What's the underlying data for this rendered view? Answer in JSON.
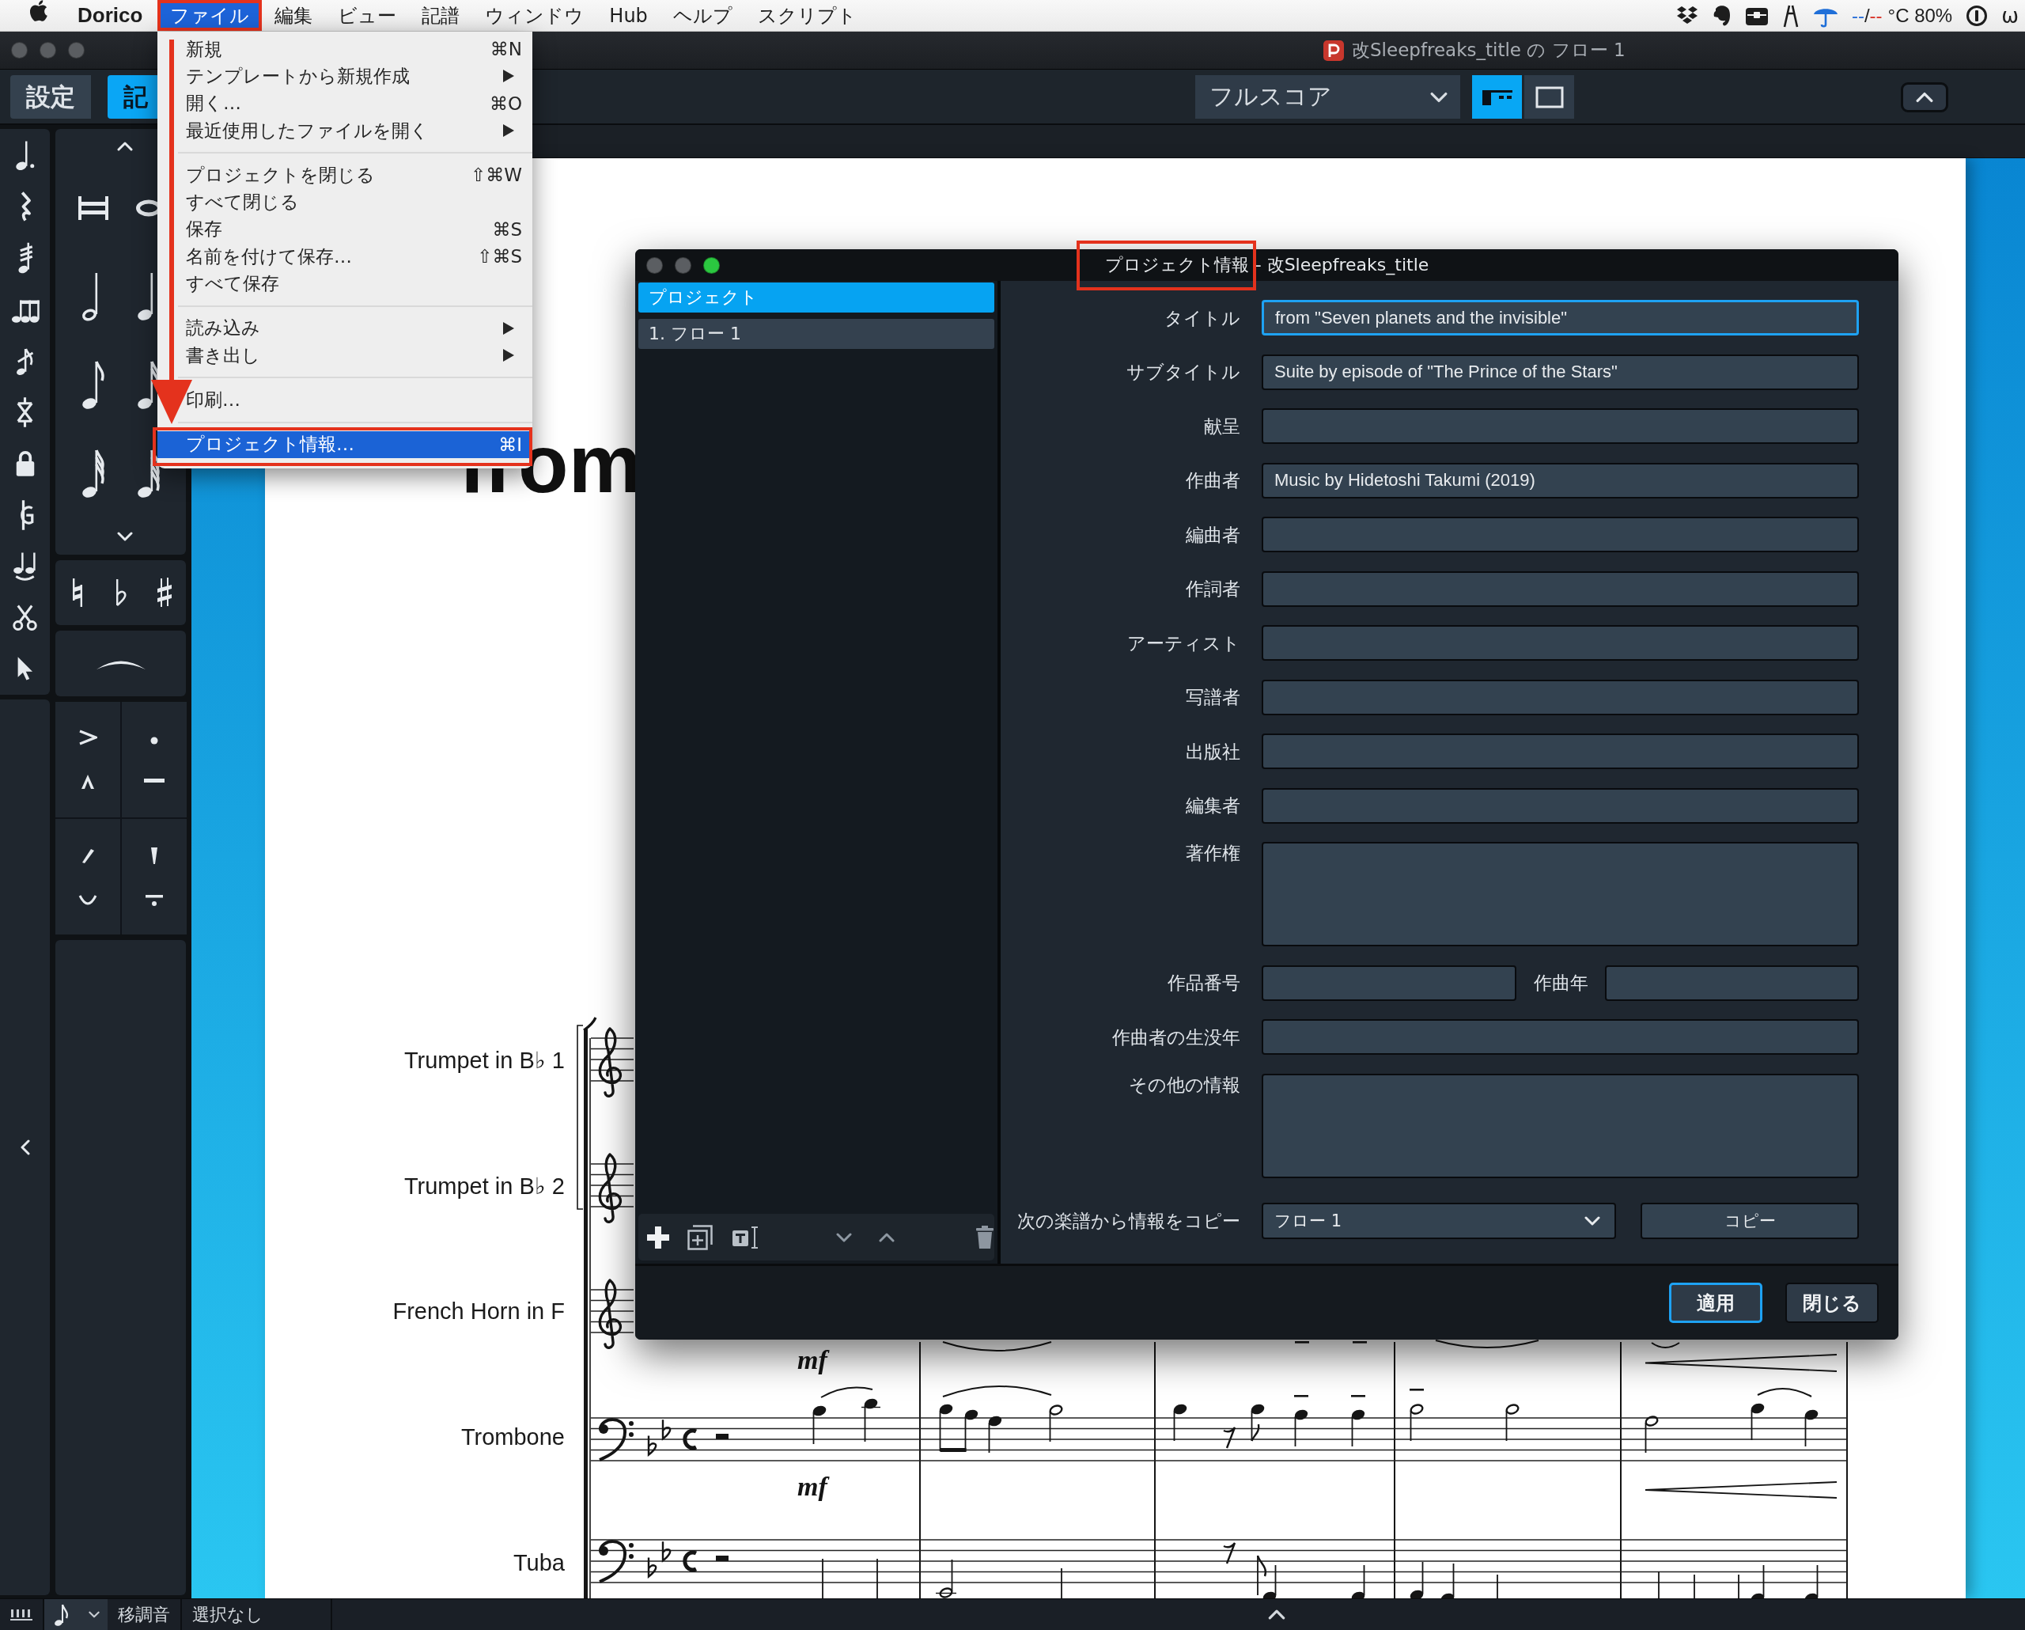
{
  "menubar": {
    "app": "Dorico",
    "items": [
      {
        "label": "ファイル",
        "selected": true,
        "annotated": true
      },
      {
        "label": "編集",
        "selected": false,
        "annotated": false
      },
      {
        "label": "ビュー",
        "selected": false,
        "annotated": false
      },
      {
        "label": "記譜",
        "selected": false,
        "annotated": false
      },
      {
        "label": "ウィンドウ",
        "selected": false,
        "annotated": false
      },
      {
        "label": "Hub",
        "selected": false,
        "annotated": false
      },
      {
        "label": "ヘルプ",
        "selected": false,
        "annotated": false
      },
      {
        "label": "スクリプト",
        "selected": false,
        "annotated": false
      }
    ],
    "weather": {
      "low": "--",
      "separator": "/",
      "high": "--",
      "reading": "°C 80%"
    },
    "status_glyph": "ω"
  },
  "window": {
    "title": "改Sleepfreaks_title の フロー 1"
  },
  "toolbar": {
    "modes": [
      {
        "label": "設定",
        "selected": false
      },
      {
        "label": "記",
        "selected": true
      }
    ],
    "layout": "フルスコア",
    "views": [
      {
        "kind": "galley",
        "selected": true
      },
      {
        "kind": "page",
        "selected": false
      }
    ]
  },
  "file_menu": {
    "groups": [
      {
        "items": [
          {
            "label": "新規",
            "shortcut": "⌘N",
            "submenu": false,
            "selected": false,
            "annotated": false
          },
          {
            "label": "テンプレートから新規作成",
            "submenu": true,
            "selected": false,
            "annotated": false
          },
          {
            "label": "開く…",
            "shortcut": "⌘O",
            "submenu": false,
            "selected": false,
            "annotated": false
          },
          {
            "label": "最近使用したファイルを開く",
            "submenu": true,
            "selected": false,
            "annotated": false
          }
        ]
      },
      {
        "items": [
          {
            "label": "プロジェクトを閉じる",
            "shortcut": "⇧⌘W",
            "submenu": false,
            "selected": false,
            "annotated": false
          },
          {
            "label": "すべて閉じる",
            "submenu": false,
            "selected": false,
            "annotated": false
          },
          {
            "label": "保存",
            "shortcut": "⌘S",
            "submenu": false,
            "selected": false,
            "annotated": false
          },
          {
            "label": "名前を付けて保存…",
            "shortcut": "⇧⌘S",
            "submenu": false,
            "selected": false,
            "annotated": false
          },
          {
            "label": "すべて保存",
            "submenu": false,
            "selected": false,
            "annotated": false
          }
        ]
      },
      {
        "items": [
          {
            "label": "読み込み",
            "submenu": true,
            "selected": false,
            "annotated": false
          },
          {
            "label": "書き出し",
            "submenu": true,
            "selected": false,
            "annotated": false
          }
        ]
      },
      {
        "items": [
          {
            "label": "印刷…",
            "submenu": false,
            "selected": false,
            "annotated": false
          }
        ]
      },
      {
        "items": [
          {
            "label": "プロジェクト情報…",
            "shortcut": "⌘I",
            "submenu": false,
            "selected": true,
            "annotated": true
          }
        ]
      }
    ]
  },
  "score": {
    "title": "from",
    "instruments": [
      "Trumpet in B♭ 1",
      "Trumpet in B♭ 2",
      "French Horn in F",
      "Trombone",
      "Tuba"
    ],
    "dynamics": [
      "mf",
      "mf"
    ]
  },
  "dialog": {
    "title": "プロジェクト情報",
    "title_annotated": true,
    "subtitle": "- 改Sleepfreaks_title",
    "list": [
      {
        "label": "プロジェクト",
        "selected": true
      },
      {
        "label": "1. フロー 1",
        "selected": false
      }
    ],
    "fields": [
      {
        "kind": "line",
        "label": "タイトル",
        "value": "from \"Seven planets and the invisible\"",
        "focused": true
      },
      {
        "kind": "line",
        "label": "サブタイトル",
        "value": "Suite by episode of \"The Prince of the Stars\"",
        "focused": false
      },
      {
        "kind": "line",
        "label": "献呈",
        "focused": false
      },
      {
        "kind": "line",
        "label": "作曲者",
        "value": "Music by Hidetoshi Takumi (2019)",
        "focused": false
      },
      {
        "kind": "line",
        "label": "編曲者",
        "focused": false
      },
      {
        "kind": "line",
        "label": "作詞者",
        "focused": false
      },
      {
        "kind": "line",
        "label": "アーティスト",
        "focused": false
      },
      {
        "kind": "line",
        "label": "写譜者",
        "focused": false
      },
      {
        "kind": "line",
        "label": "出版社",
        "focused": false
      },
      {
        "kind": "line",
        "label": "編集者",
        "focused": false
      },
      {
        "kind": "area",
        "label": "著作権",
        "focused": false
      },
      {
        "kind": "pair",
        "label": "作品番号",
        "second_label": "作曲年",
        "focused": false
      },
      {
        "kind": "line",
        "label": "作曲者の生没年",
        "focused": false
      },
      {
        "kind": "area",
        "label": "その他の情報",
        "focused": false
      }
    ],
    "copy": {
      "label": "次の楽譜から情報をコピー",
      "source": "フロー 1",
      "button": "コピー"
    },
    "buttons": [
      {
        "label": "適用",
        "default": true
      },
      {
        "label": "閉じる",
        "default": false
      }
    ]
  },
  "status_bar": {
    "transpose": "移調音",
    "selection": "選択なし"
  }
}
